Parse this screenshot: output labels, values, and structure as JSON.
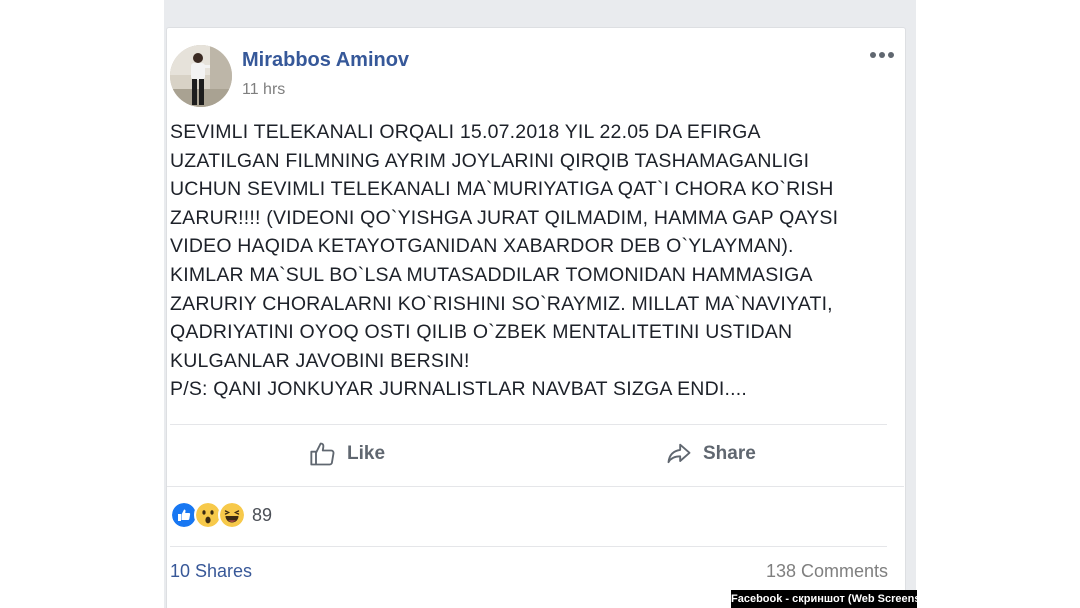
{
  "post": {
    "author": "Mirabbos Aminov",
    "timestamp": "11 hrs",
    "lines": [
      "SEVIMLI TELEKANALI ORQALI 15.07.2018 YIL 22.05 DA EFIRGA",
      "UZATILGAN FILMNING AYRIM JOYLARINI QIRQIB TASHAMAGANLIGI",
      "UCHUN SEVIMLI TELEKANALI MA`MURIYATIGA QAT`I CHORA KO`RISH",
      "ZARUR!!!! (VIDEONI QO`YISHGA JURAT QILMADIM, HAMMA GAP QAYSI",
      "VIDEO HAQIDA KETAYOTGANIDAN XABARDOR DEB O`YLAYMAN).",
      "KIMLAR MA`SUL BO`LSA MUTASADDILAR TOMONIDAN HAMMASIGA",
      "ZARURIY CHORALARNI KO`RISHINI SO`RAYMIZ. MILLAT MA`NAVIYATI,",
      "QADRIYATINI OYOQ OSTI QILIB O`ZBEK MENTALITETINI USTIDAN",
      "KULGANLAR JAVOBINI BERSIN!",
      "P/S: QANI JONKUYAR JURNALISTLAR NAVBAT SIZGA ENDI...."
    ]
  },
  "actions": {
    "like_label": "Like",
    "share_label": "Share"
  },
  "stats": {
    "reaction_icons": [
      "like-icon",
      "wow-icon",
      "haha-icon"
    ],
    "reaction_count": "89",
    "shares": "10 Shares",
    "comments": "138 Comments"
  },
  "caption": "Facebook - скриншот (Web Screenshot)",
  "colors": {
    "author": "#365899",
    "like_blue": "#1877f2",
    "emoji_yellow": "#f7c94a",
    "feed_background": "#e9ebee"
  }
}
